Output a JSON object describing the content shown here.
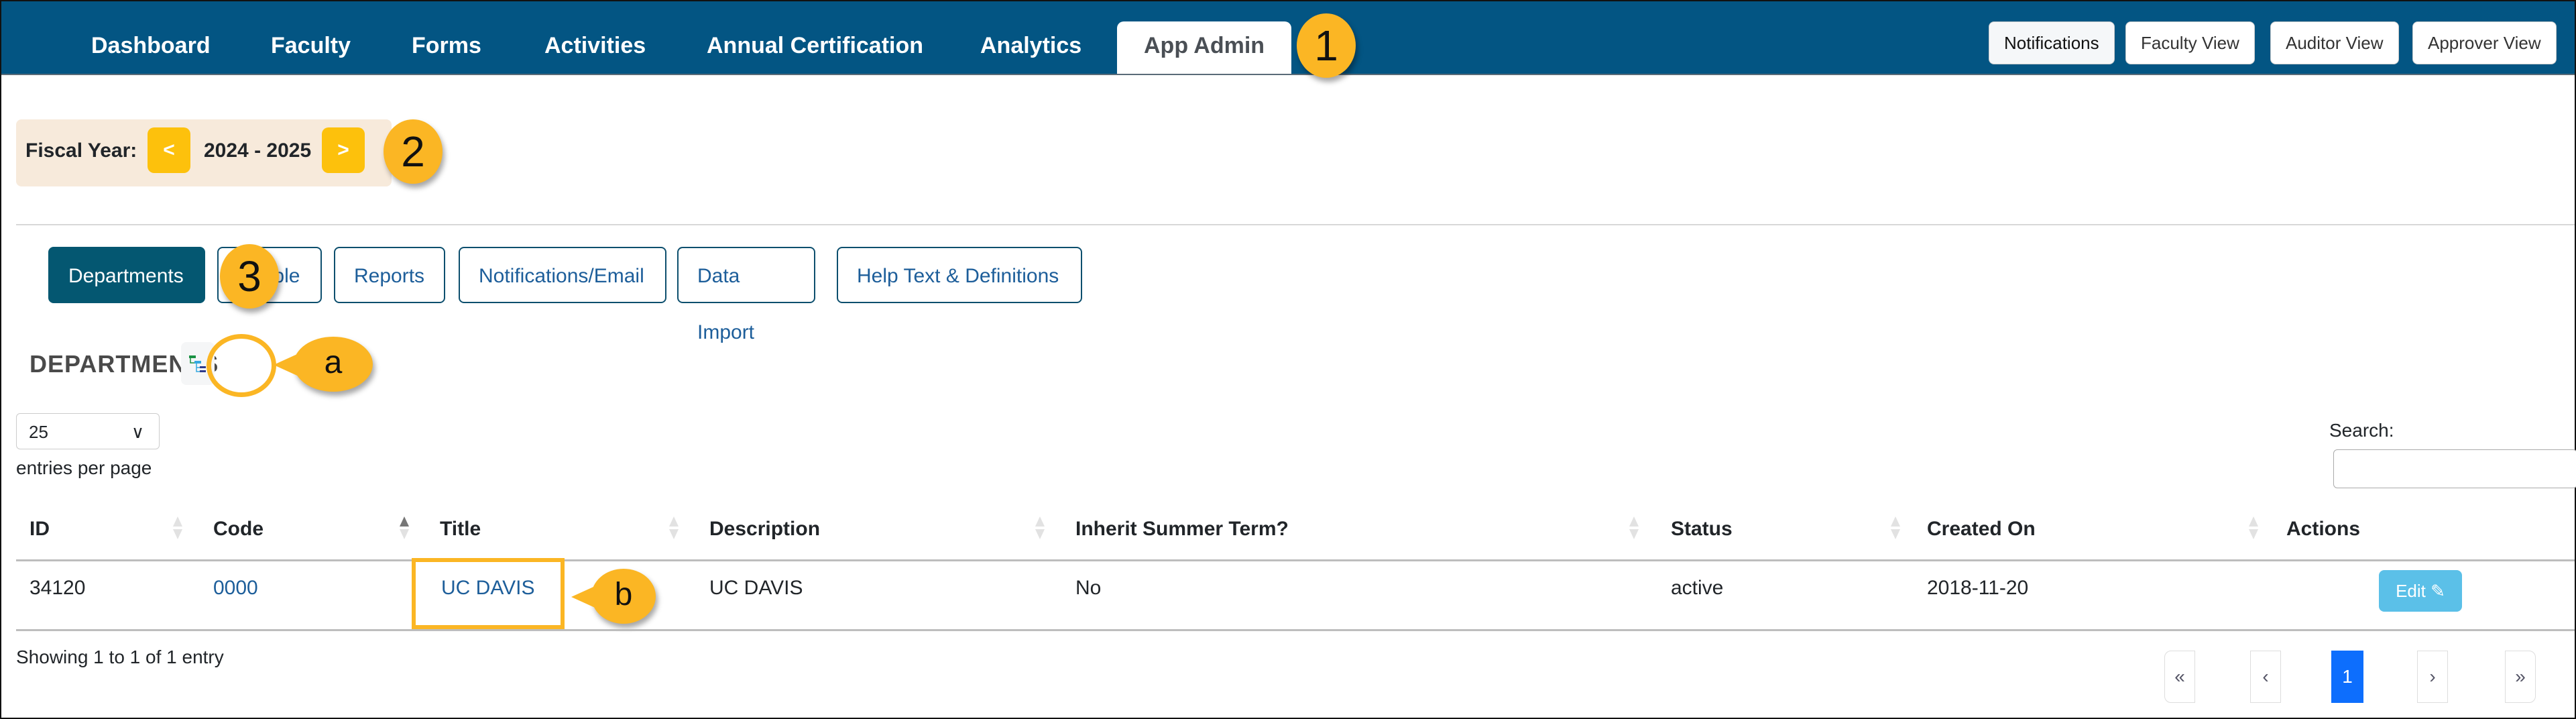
{
  "nav": {
    "items": [
      {
        "label": "Dashboard"
      },
      {
        "label": "Faculty"
      },
      {
        "label": "Forms"
      },
      {
        "label": "Activities"
      },
      {
        "label": "Annual Certification"
      },
      {
        "label": "Analytics"
      },
      {
        "label": "App Admin",
        "active": true
      }
    ],
    "view_buttons": [
      {
        "label": "Notifications"
      },
      {
        "label": "Faculty View"
      },
      {
        "label": "Auditor View"
      },
      {
        "label": "Approver View"
      }
    ]
  },
  "fiscal_year": {
    "label": "Fiscal Year:",
    "prev": "<",
    "value": "2024 - 2025",
    "next": ">"
  },
  "admin_tabs": [
    {
      "label": "Departments",
      "active": true
    },
    {
      "label": "People"
    },
    {
      "label": "Reports"
    },
    {
      "label": "Notifications/Email"
    },
    {
      "label": "Data Import"
    },
    {
      "label": "Help Text & Definitions"
    }
  ],
  "section": {
    "title": "DEPARTMENTS",
    "tree_icon": "org-tree-icon"
  },
  "table_controls": {
    "page_size": "25",
    "page_size_label": "entries per page",
    "search_label": "Search:",
    "search_value": ""
  },
  "table": {
    "columns": [
      "ID",
      "Code",
      "Title",
      "Description",
      "Inherit Summer Term?",
      "Status",
      "Created On",
      "Actions"
    ],
    "rows": [
      {
        "id": "34120",
        "code": "0000",
        "title": "UC DAVIS",
        "description": "UC DAVIS",
        "inherit_summer": "No",
        "status": "active",
        "created_on": "2018-11-20",
        "action": "Edit"
      }
    ]
  },
  "footer": {
    "summary": "Showing 1 to 1 of 1 entry",
    "pagination": {
      "first": "«",
      "prev": "‹",
      "current": "1",
      "next": "›",
      "last": "»"
    }
  },
  "callouts": {
    "one": "1",
    "two": "2",
    "three": "3",
    "a": "a",
    "b": "b"
  },
  "colors": {
    "navbar": "#035583",
    "active_subtab": "#045771",
    "fy_button": "#fdc10c",
    "callout": "#fbb624",
    "edit_button": "#5bc0e8",
    "page_current": "#0d6efd"
  }
}
